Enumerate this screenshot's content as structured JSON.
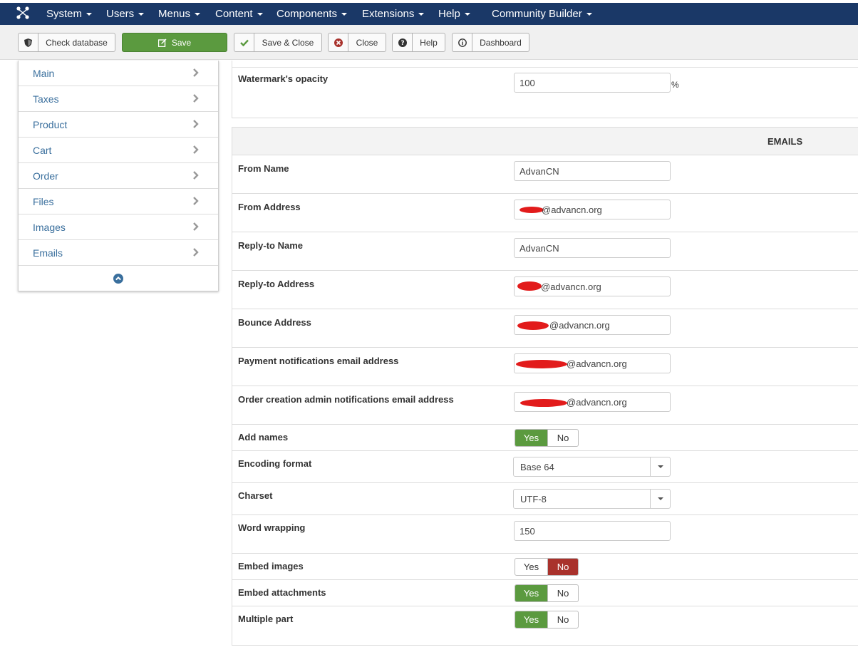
{
  "nav": {
    "items": [
      {
        "label": "System"
      },
      {
        "label": "Users"
      },
      {
        "label": "Menus"
      },
      {
        "label": "Content"
      },
      {
        "label": "Components"
      },
      {
        "label": "Extensions"
      },
      {
        "label": "Help"
      },
      {
        "label": "Community Builder"
      }
    ]
  },
  "toolbar": {
    "check_database": "Check database",
    "save": "Save",
    "save_close": "Save & Close",
    "close": "Close",
    "help": "Help",
    "dashboard": "Dashboard"
  },
  "sidebar": {
    "items": [
      {
        "label": "Main"
      },
      {
        "label": "Taxes"
      },
      {
        "label": "Product"
      },
      {
        "label": "Cart"
      },
      {
        "label": "Order"
      },
      {
        "label": "Files"
      },
      {
        "label": "Images"
      },
      {
        "label": "Emails"
      }
    ]
  },
  "watermark": {
    "label": "Watermark's opacity",
    "value": "100",
    "unit": "%"
  },
  "emails": {
    "section_title": "EMAILS",
    "from_name": {
      "label": "From Name",
      "value": "AdvanCN"
    },
    "from_address": {
      "label": "From Address",
      "value": "@advancn.org"
    },
    "reply_to_name": {
      "label": "Reply-to Name",
      "value": "AdvanCN"
    },
    "reply_to_address": {
      "label": "Reply-to Address",
      "value": "@advancn.org"
    },
    "bounce_address": {
      "label": "Bounce Address",
      "value": "@advancn.org"
    },
    "payment_notifications": {
      "label": "Payment notifications email address",
      "value": "@advancn.org"
    },
    "order_creation": {
      "label": "Order creation admin notifications email address",
      "value": "@advancn.org"
    },
    "add_names": {
      "label": "Add names",
      "yes": "Yes",
      "no": "No",
      "selected": "Yes"
    },
    "encoding_format": {
      "label": "Encoding format",
      "value": "Base 64"
    },
    "charset": {
      "label": "Charset",
      "value": "UTF-8"
    },
    "word_wrapping": {
      "label": "Word wrapping",
      "value": "150"
    },
    "embed_images": {
      "label": "Embed images",
      "yes": "Yes",
      "no": "No",
      "selected": "No"
    },
    "embed_attachments": {
      "label": "Embed attachments",
      "yes": "Yes",
      "no": "No",
      "selected": "Yes"
    },
    "multiple_part": {
      "label": "Multiple part",
      "yes": "Yes",
      "no": "No",
      "selected": "Yes"
    }
  },
  "colors": {
    "topbar": "#1a3867",
    "save_green": "#5b9a3f",
    "no_red": "#a9322c",
    "link_blue": "#3a6f9d",
    "redaction": "#e21b1b"
  }
}
